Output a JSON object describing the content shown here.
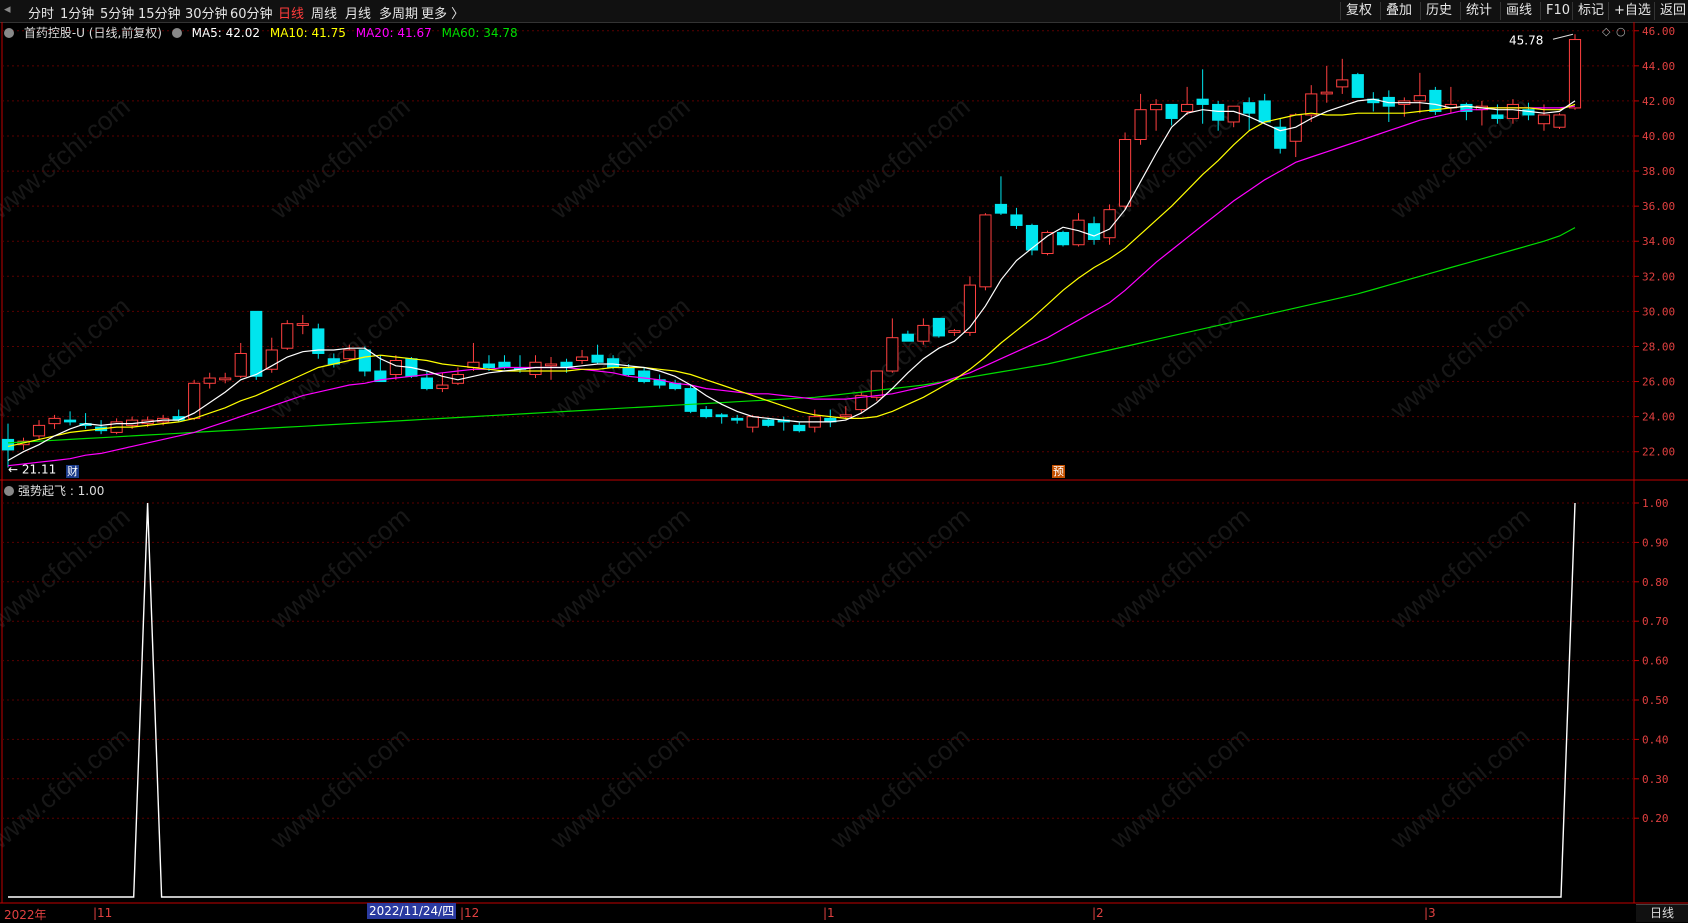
{
  "toolbar": {
    "periods": [
      "分时",
      "1分钟",
      "5分钟",
      "15分钟",
      "30分钟",
      "60分钟",
      "日线",
      "周线",
      "月线",
      "多周期",
      "更多 〉"
    ],
    "active_period": "日线",
    "right_buttons": [
      "复权",
      "叠加",
      "历史",
      "统计",
      "画线",
      "F10",
      "标记",
      "+自选",
      "返回"
    ]
  },
  "info": {
    "stock": "首药控股-U (日线,前复权)",
    "ma5": "MA5: 42.02",
    "ma10": "MA10: 41.75",
    "ma20": "MA20: 41.67",
    "ma60": "MA60: 34.78"
  },
  "colors": {
    "up": "#ff4040",
    "down": "#00e5ee",
    "ma5": "#ffffff",
    "ma10": "#ffff00",
    "ma20": "#ff00ff",
    "ma60": "#00dd00",
    "grid": "#5a0000",
    "axis": "#c00000"
  },
  "price_axis": [
    "46.00",
    "44.00",
    "42.00",
    "40.00",
    "38.00",
    "36.00",
    "34.00",
    "32.00",
    "30.00",
    "28.00",
    "26.00",
    "24.00",
    "22.00"
  ],
  "indicator": {
    "label": "强势起飞 : 1.00",
    "axis": [
      "1.00",
      "0.90",
      "0.80",
      "0.70",
      "0.60",
      "0.50",
      "0.40",
      "0.30",
      "0.20"
    ]
  },
  "annotations": {
    "high": "45.78",
    "low": "21.11",
    "marker_cai": "财",
    "marker_yu": "预"
  },
  "dates": {
    "labels": [
      "2022年",
      "11",
      "12",
      "1",
      "2",
      "3"
    ],
    "cursor": "2022/11/24/四",
    "period_tab": "日线"
  },
  "watermark": "www.cfchi.com",
  "chart_data": {
    "type": "candlestick",
    "ylim": [
      20.5,
      46.5
    ],
    "candles": [
      [
        22.7,
        23.6,
        21.1,
        22.1
      ],
      [
        22.4,
        22.8,
        22.1,
        22.6
      ],
      [
        22.9,
        23.8,
        22.7,
        23.5
      ],
      [
        23.6,
        24.1,
        23.3,
        23.9
      ],
      [
        23.8,
        24.3,
        23.5,
        23.7
      ],
      [
        23.6,
        24.2,
        23.3,
        23.5
      ],
      [
        23.4,
        23.8,
        23.0,
        23.2
      ],
      [
        23.1,
        23.9,
        23.0,
        23.7
      ],
      [
        23.5,
        24.0,
        23.3,
        23.8
      ],
      [
        23.6,
        24.0,
        23.4,
        23.8
      ],
      [
        23.7,
        24.1,
        23.5,
        23.9
      ],
      [
        24.0,
        24.4,
        23.7,
        23.8
      ],
      [
        23.9,
        26.1,
        23.8,
        25.9
      ],
      [
        25.9,
        26.5,
        25.6,
        26.2
      ],
      [
        26.1,
        26.5,
        25.9,
        26.2
      ],
      [
        26.3,
        28.2,
        26.2,
        27.6
      ],
      [
        30.0,
        30.0,
        26.1,
        26.3
      ],
      [
        26.7,
        28.5,
        26.5,
        27.8
      ],
      [
        27.9,
        29.5,
        27.8,
        29.3
      ],
      [
        29.2,
        29.8,
        28.7,
        29.3
      ],
      [
        29.0,
        29.3,
        27.3,
        27.6
      ],
      [
        27.3,
        27.6,
        26.8,
        27.0
      ],
      [
        27.3,
        28.1,
        27.2,
        27.8
      ],
      [
        27.8,
        28.0,
        26.3,
        26.6
      ],
      [
        26.6,
        27.5,
        26.5,
        26.0
      ],
      [
        26.4,
        27.5,
        26.1,
        27.2
      ],
      [
        27.3,
        27.4,
        26.2,
        26.3
      ],
      [
        26.2,
        26.6,
        25.5,
        25.6
      ],
      [
        25.6,
        26.5,
        25.4,
        25.8
      ],
      [
        25.9,
        26.8,
        25.8,
        26.4
      ],
      [
        26.8,
        28.2,
        26.6,
        27.1
      ],
      [
        27.0,
        27.5,
        26.6,
        26.8
      ],
      [
        27.1,
        27.5,
        26.7,
        26.8
      ],
      [
        26.8,
        27.5,
        26.5,
        26.7
      ],
      [
        26.4,
        27.5,
        26.2,
        27.1
      ],
      [
        26.9,
        27.4,
        26.1,
        27.0
      ],
      [
        27.1,
        27.3,
        26.5,
        26.8
      ],
      [
        27.2,
        27.8,
        27.0,
        27.4
      ],
      [
        27.5,
        28.1,
        27.0,
        27.1
      ],
      [
        27.3,
        27.5,
        26.7,
        26.8
      ],
      [
        26.8,
        27.0,
        26.3,
        26.4
      ],
      [
        26.6,
        26.8,
        25.9,
        26.0
      ],
      [
        26.1,
        26.4,
        25.6,
        25.8
      ],
      [
        25.9,
        26.1,
        25.5,
        25.6
      ],
      [
        25.6,
        25.8,
        24.2,
        24.3
      ],
      [
        24.4,
        24.6,
        23.9,
        24.0
      ],
      [
        24.1,
        24.2,
        23.6,
        24.0
      ],
      [
        23.9,
        24.1,
        23.6,
        23.8
      ],
      [
        23.4,
        24.1,
        23.1,
        24.0
      ],
      [
        23.8,
        23.9,
        23.4,
        23.5
      ],
      [
        23.8,
        24.0,
        23.2,
        23.7
      ],
      [
        23.5,
        23.7,
        23.1,
        23.2
      ],
      [
        23.4,
        24.4,
        23.1,
        24.0
      ],
      [
        23.9,
        24.4,
        23.4,
        23.7
      ],
      [
        24.0,
        24.6,
        23.8,
        24.1
      ],
      [
        24.4,
        25.4,
        24.2,
        25.2
      ],
      [
        25.1,
        26.6,
        24.9,
        26.6
      ],
      [
        26.6,
        29.6,
        26.5,
        28.5
      ],
      [
        28.7,
        28.9,
        28.3,
        28.3
      ],
      [
        28.3,
        29.6,
        28.1,
        29.2
      ],
      [
        29.6,
        29.6,
        28.5,
        28.6
      ],
      [
        28.8,
        29.0,
        28.6,
        28.9
      ],
      [
        28.8,
        32.0,
        28.6,
        31.5
      ],
      [
        31.4,
        35.6,
        31.2,
        35.5
      ],
      [
        36.1,
        37.7,
        35.5,
        35.6
      ],
      [
        35.5,
        35.9,
        34.7,
        34.9
      ],
      [
        34.9,
        35.0,
        33.2,
        33.5
      ],
      [
        33.3,
        34.6,
        33.2,
        34.5
      ],
      [
        34.5,
        34.6,
        33.7,
        33.8
      ],
      [
        33.8,
        35.6,
        33.7,
        35.2
      ],
      [
        35.0,
        35.4,
        33.8,
        34.1
      ],
      [
        34.2,
        36.1,
        33.8,
        35.8
      ],
      [
        36.0,
        40.2,
        35.8,
        39.8
      ],
      [
        39.8,
        42.4,
        39.5,
        41.5
      ],
      [
        41.5,
        42.1,
        40.3,
        41.8
      ],
      [
        41.8,
        41.8,
        40.6,
        41.0
      ],
      [
        41.4,
        42.8,
        41.2,
        41.8
      ],
      [
        42.1,
        43.8,
        40.7,
        41.8
      ],
      [
        41.8,
        42.0,
        40.3,
        40.9
      ],
      [
        40.8,
        41.7,
        40.5,
        41.7
      ],
      [
        41.9,
        42.2,
        40.3,
        41.3
      ],
      [
        42.0,
        42.4,
        40.8,
        40.8
      ],
      [
        40.5,
        41.0,
        39.0,
        39.3
      ],
      [
        39.7,
        41.3,
        38.8,
        41.2
      ],
      [
        41.2,
        42.9,
        40.8,
        42.4
      ],
      [
        42.4,
        44.0,
        41.9,
        42.5
      ],
      [
        42.8,
        44.4,
        42.4,
        43.2
      ],
      [
        43.5,
        43.6,
        42.2,
        42.2
      ],
      [
        42.1,
        42.5,
        41.4,
        41.9
      ],
      [
        42.2,
        42.6,
        40.8,
        41.7
      ],
      [
        41.8,
        42.2,
        41.1,
        42.0
      ],
      [
        42.0,
        43.6,
        41.3,
        42.3
      ],
      [
        42.6,
        42.8,
        41.2,
        41.4
      ],
      [
        41.6,
        42.8,
        41.3,
        41.8
      ],
      [
        41.8,
        41.9,
        40.9,
        41.4
      ],
      [
        41.5,
        42.0,
        40.6,
        41.7
      ],
      [
        41.2,
        41.8,
        40.7,
        41.0
      ],
      [
        41.0,
        42.1,
        40.7,
        41.8
      ],
      [
        41.5,
        41.9,
        40.9,
        41.2
      ],
      [
        40.7,
        41.8,
        40.3,
        41.2
      ],
      [
        40.5,
        41.3,
        40.4,
        41.2
      ],
      [
        41.6,
        45.8,
        41.5,
        45.5
      ]
    ],
    "ma5": [
      21.5,
      22.0,
      22.4,
      22.9,
      23.3,
      23.6,
      23.5,
      23.6,
      23.6,
      23.7,
      23.8,
      23.8,
      24.2,
      24.8,
      25.4,
      26.1,
      26.4,
      26.9,
      27.4,
      27.7,
      27.8,
      27.8,
      27.9,
      27.9,
      27.3,
      26.9,
      26.8,
      26.6,
      26.3,
      26.1,
      26.3,
      26.5,
      26.6,
      26.7,
      26.8,
      26.8,
      26.8,
      26.9,
      27.0,
      27.0,
      26.9,
      26.8,
      26.6,
      26.3,
      25.8,
      25.2,
      24.7,
      24.3,
      24.0,
      23.9,
      23.8,
      23.7,
      23.7,
      23.7,
      23.8,
      24.2,
      24.8,
      25.6,
      26.5,
      27.3,
      27.9,
      28.3,
      29.1,
      30.3,
      31.8,
      32.9,
      33.6,
      34.3,
      34.8,
      34.6,
      34.3,
      34.7,
      35.8,
      37.4,
      39.0,
      40.5,
      41.3,
      41.5,
      41.4,
      41.4,
      41.1,
      40.7,
      40.3,
      40.5,
      41.0,
      41.4,
      41.7,
      42.0,
      42.1,
      41.9,
      41.9,
      41.9,
      41.8,
      41.6,
      41.7,
      41.6,
      41.5,
      41.5,
      41.4,
      41.3,
      41.4,
      42.0
    ],
    "ma10": [
      22.3,
      22.5,
      22.7,
      22.9,
      23.1,
      23.2,
      23.3,
      23.4,
      23.4,
      23.5,
      23.6,
      23.7,
      23.9,
      24.2,
      24.5,
      24.9,
      25.2,
      25.6,
      26.0,
      26.4,
      26.8,
      27.0,
      27.2,
      27.4,
      27.5,
      27.4,
      27.3,
      27.2,
      27.0,
      26.9,
      26.8,
      26.7,
      26.6,
      26.6,
      26.6,
      26.6,
      26.6,
      26.7,
      26.7,
      26.8,
      26.8,
      26.8,
      26.7,
      26.6,
      26.4,
      26.1,
      25.8,
      25.5,
      25.2,
      24.9,
      24.6,
      24.3,
      24.1,
      24.0,
      23.9,
      23.9,
      24.0,
      24.3,
      24.7,
      25.1,
      25.6,
      26.1,
      26.7,
      27.4,
      28.2,
      28.9,
      29.6,
      30.4,
      31.2,
      31.9,
      32.5,
      33.0,
      33.6,
      34.4,
      35.2,
      36.0,
      36.9,
      37.8,
      38.6,
      39.5,
      40.3,
      40.8,
      41.0,
      41.2,
      41.3,
      41.2,
      41.2,
      41.3,
      41.3,
      41.3,
      41.3,
      41.4,
      41.5,
      41.6,
      41.7,
      41.6,
      41.6,
      41.6,
      41.6,
      41.5,
      41.5,
      41.8
    ],
    "ma20": [
      21.2,
      21.3,
      21.4,
      21.5,
      21.6,
      21.8,
      21.9,
      22.1,
      22.3,
      22.5,
      22.7,
      22.9,
      23.1,
      23.4,
      23.7,
      24.0,
      24.3,
      24.6,
      24.9,
      25.2,
      25.4,
      25.6,
      25.8,
      25.9,
      26.1,
      26.2,
      26.3,
      26.4,
      26.5,
      26.6,
      26.7,
      26.7,
      26.8,
      26.8,
      26.8,
      26.8,
      26.8,
      26.7,
      26.6,
      26.5,
      26.3,
      26.2,
      26.1,
      25.9,
      25.8,
      25.6,
      25.5,
      25.4,
      25.3,
      25.3,
      25.2,
      25.1,
      25.0,
      25.0,
      25.0,
      25.1,
      25.2,
      25.3,
      25.5,
      25.7,
      25.9,
      26.2,
      26.5,
      26.9,
      27.3,
      27.7,
      28.1,
      28.5,
      29.0,
      29.5,
      30.0,
      30.5,
      31.2,
      32.0,
      32.8,
      33.5,
      34.2,
      34.9,
      35.6,
      36.3,
      36.9,
      37.5,
      38.0,
      38.5,
      38.8,
      39.1,
      39.4,
      39.7,
      40.0,
      40.3,
      40.6,
      40.9,
      41.1,
      41.3,
      41.5,
      41.5,
      41.6,
      41.6,
      41.6,
      41.6,
      41.6,
      41.7
    ],
    "ma60": [
      22.5,
      22.55,
      22.6,
      22.65,
      22.7,
      22.75,
      22.8,
      22.85,
      22.9,
      22.95,
      23.0,
      23.05,
      23.1,
      23.15,
      23.2,
      23.25,
      23.3,
      23.35,
      23.4,
      23.45,
      23.5,
      23.55,
      23.6,
      23.65,
      23.7,
      23.75,
      23.8,
      23.85,
      23.9,
      23.95,
      24.0,
      24.05,
      24.1,
      24.15,
      24.2,
      24.25,
      24.3,
      24.35,
      24.4,
      24.45,
      24.5,
      24.55,
      24.6,
      24.65,
      24.7,
      24.75,
      24.8,
      24.85,
      24.9,
      24.95,
      25.0,
      25.05,
      25.1,
      25.2,
      25.3,
      25.4,
      25.5,
      25.6,
      25.7,
      25.8,
      25.95,
      26.1,
      26.25,
      26.4,
      26.55,
      26.7,
      26.85,
      27.0,
      27.2,
      27.4,
      27.6,
      27.8,
      28.0,
      28.2,
      28.4,
      28.6,
      28.8,
      29.0,
      29.2,
      29.4,
      29.6,
      29.8,
      30.0,
      30.2,
      30.4,
      30.6,
      30.8,
      31.0,
      31.25,
      31.5,
      31.75,
      32.0,
      32.25,
      32.5,
      32.75,
      33.0,
      33.25,
      33.5,
      33.75,
      34.0,
      34.3,
      34.78
    ],
    "indicator": [
      0,
      0,
      0,
      0,
      0,
      0,
      0,
      0,
      0,
      1,
      0,
      0,
      0,
      0,
      0,
      0,
      0,
      0,
      0,
      0,
      0,
      0,
      0,
      0,
      0,
      0,
      0,
      0,
      0,
      0,
      0,
      0,
      0,
      0,
      0,
      0,
      0,
      0,
      0,
      0,
      0,
      0,
      0,
      0,
      0,
      0,
      0,
      0,
      0,
      0,
      0,
      0,
      0,
      0,
      0,
      0,
      0,
      0,
      0,
      0,
      0,
      0,
      0,
      0,
      0,
      0,
      0,
      0,
      0,
      0,
      0,
      0,
      0,
      0,
      0,
      0,
      0,
      0,
      0,
      0,
      0,
      0,
      0,
      0,
      0,
      0,
      0,
      0,
      0,
      0,
      0,
      0,
      0,
      0,
      0,
      0,
      0,
      0,
      0,
      0,
      0,
      1
    ]
  }
}
